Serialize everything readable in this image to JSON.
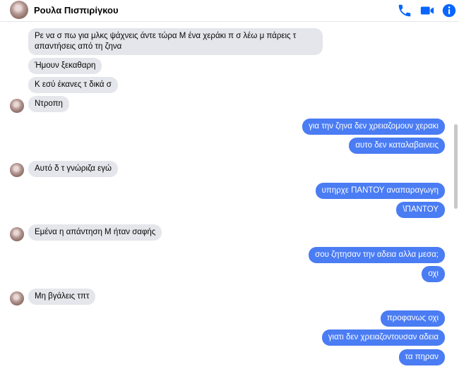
{
  "header": {
    "contact_name": "Ρουλα Πισπιρίγκου",
    "icons": [
      "phone-icon",
      "video-camera-icon",
      "info-icon"
    ]
  },
  "colors": {
    "accent": "#0866ff",
    "outgoing_bubble": "#4a7cf3",
    "incoming_bubble": "#e4e6eb"
  },
  "messages": [
    {
      "side": "in",
      "text": "Ρε να σ πω για μλκς ψάχνεις άντε τώρα Μ ένα χεράκι π σ λέω μ πάρεις τ απαντήσεις από τη ζηνα"
    },
    {
      "side": "in",
      "text": "Ήμουν ξεκαθαρη"
    },
    {
      "side": "in",
      "text": "Κ εσύ έκανες τ δικά σ"
    },
    {
      "side": "in",
      "text": "Ντροπη"
    },
    {
      "side": "out",
      "text": "για την ζηνα δεν χρειαζομουν χερακι"
    },
    {
      "side": "out",
      "text": "αυτο δεν καταλαβαινεις"
    },
    {
      "side": "in",
      "text": "Αυτό δ τ γνώριζα εγώ"
    },
    {
      "side": "out",
      "text": "υπηρχε ΠΑΝΤΟΥ αναπαραγωγη"
    },
    {
      "side": "out",
      "text": "\\ΠΑΝΤΟΥ"
    },
    {
      "side": "in",
      "text": "Εμένα η απάντηση Μ ήταν σαφής"
    },
    {
      "side": "out",
      "text": "σου ζητησαν την αδεια αλλα μεσα;"
    },
    {
      "side": "out",
      "text": "οχι"
    },
    {
      "side": "in",
      "text": "Μη βγάλεις τπτ"
    },
    {
      "side": "out",
      "text": "προφανως οχι"
    },
    {
      "side": "out",
      "text": "γιατι δεν χρειαζοντουσαν αδεια"
    },
    {
      "side": "out",
      "text": "τα πηραν"
    }
  ]
}
